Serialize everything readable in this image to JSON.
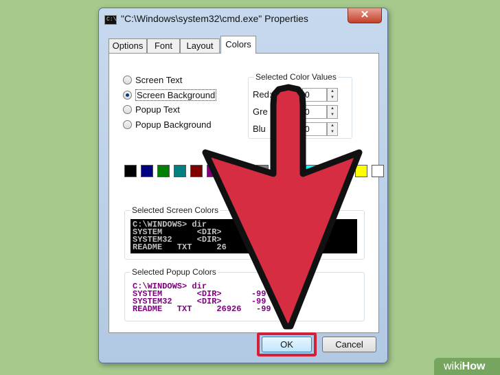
{
  "window": {
    "title": "\"C:\\Windows\\system32\\cmd.exe\" Properties",
    "title_icon": "C:\\",
    "close_glyph": "✕"
  },
  "tabs": [
    {
      "label": "Options"
    },
    {
      "label": "Font"
    },
    {
      "label": "Layout"
    },
    {
      "label": "Colors"
    }
  ],
  "radios": [
    {
      "label": "Screen Text",
      "checked": false
    },
    {
      "label": "Screen Background",
      "checked": true
    },
    {
      "label": "Popup Text",
      "checked": false
    },
    {
      "label": "Popup Background",
      "checked": false
    }
  ],
  "color_values": {
    "title": "Selected Color Values",
    "red_label": "Red:",
    "red_value": "0",
    "green_label": "Gre",
    "green_value": "0",
    "blue_label": "Blu",
    "blue_value": "0"
  },
  "palette": [
    "#000000",
    "#000080",
    "#008000",
    "#008080",
    "#800000",
    "#800080",
    "#808000",
    "#c0c0c0",
    "#808080",
    "#0000ff",
    "#00ff00",
    "#00ffff",
    "#ff0000",
    "#ff00ff",
    "#ffff00",
    "#ffffff"
  ],
  "screen_colors": {
    "title": "Selected Screen Colors",
    "lines": [
      "C:\\WINDOWS> dir",
      "SYSTEM       <DIR>           5:0",
      "SYSTEM32     <DIR>           5:0",
      "README   TXT     26          5:0"
    ],
    "text_color": "#c0c0c0",
    "bg_color": "#000000"
  },
  "popup_colors": {
    "title": "Selected Popup Colors",
    "lines": [
      "C:\\WINDOWS> dir",
      "SYSTEM       <DIR>      -99   5:0",
      "SYSTEM32     <DIR>      -99   5:0",
      "README   TXT     26926   -99   5:0"
    ],
    "text_color": "#800080",
    "bg_color": "#ffffff"
  },
  "buttons": {
    "ok": "OK",
    "cancel": "Cancel"
  },
  "colors": {
    "arrow": "#d72d43",
    "highlight": "#d51f38",
    "background": "#a6c98c"
  },
  "watermark": {
    "prefix": "wiki",
    "suffix": "How"
  }
}
